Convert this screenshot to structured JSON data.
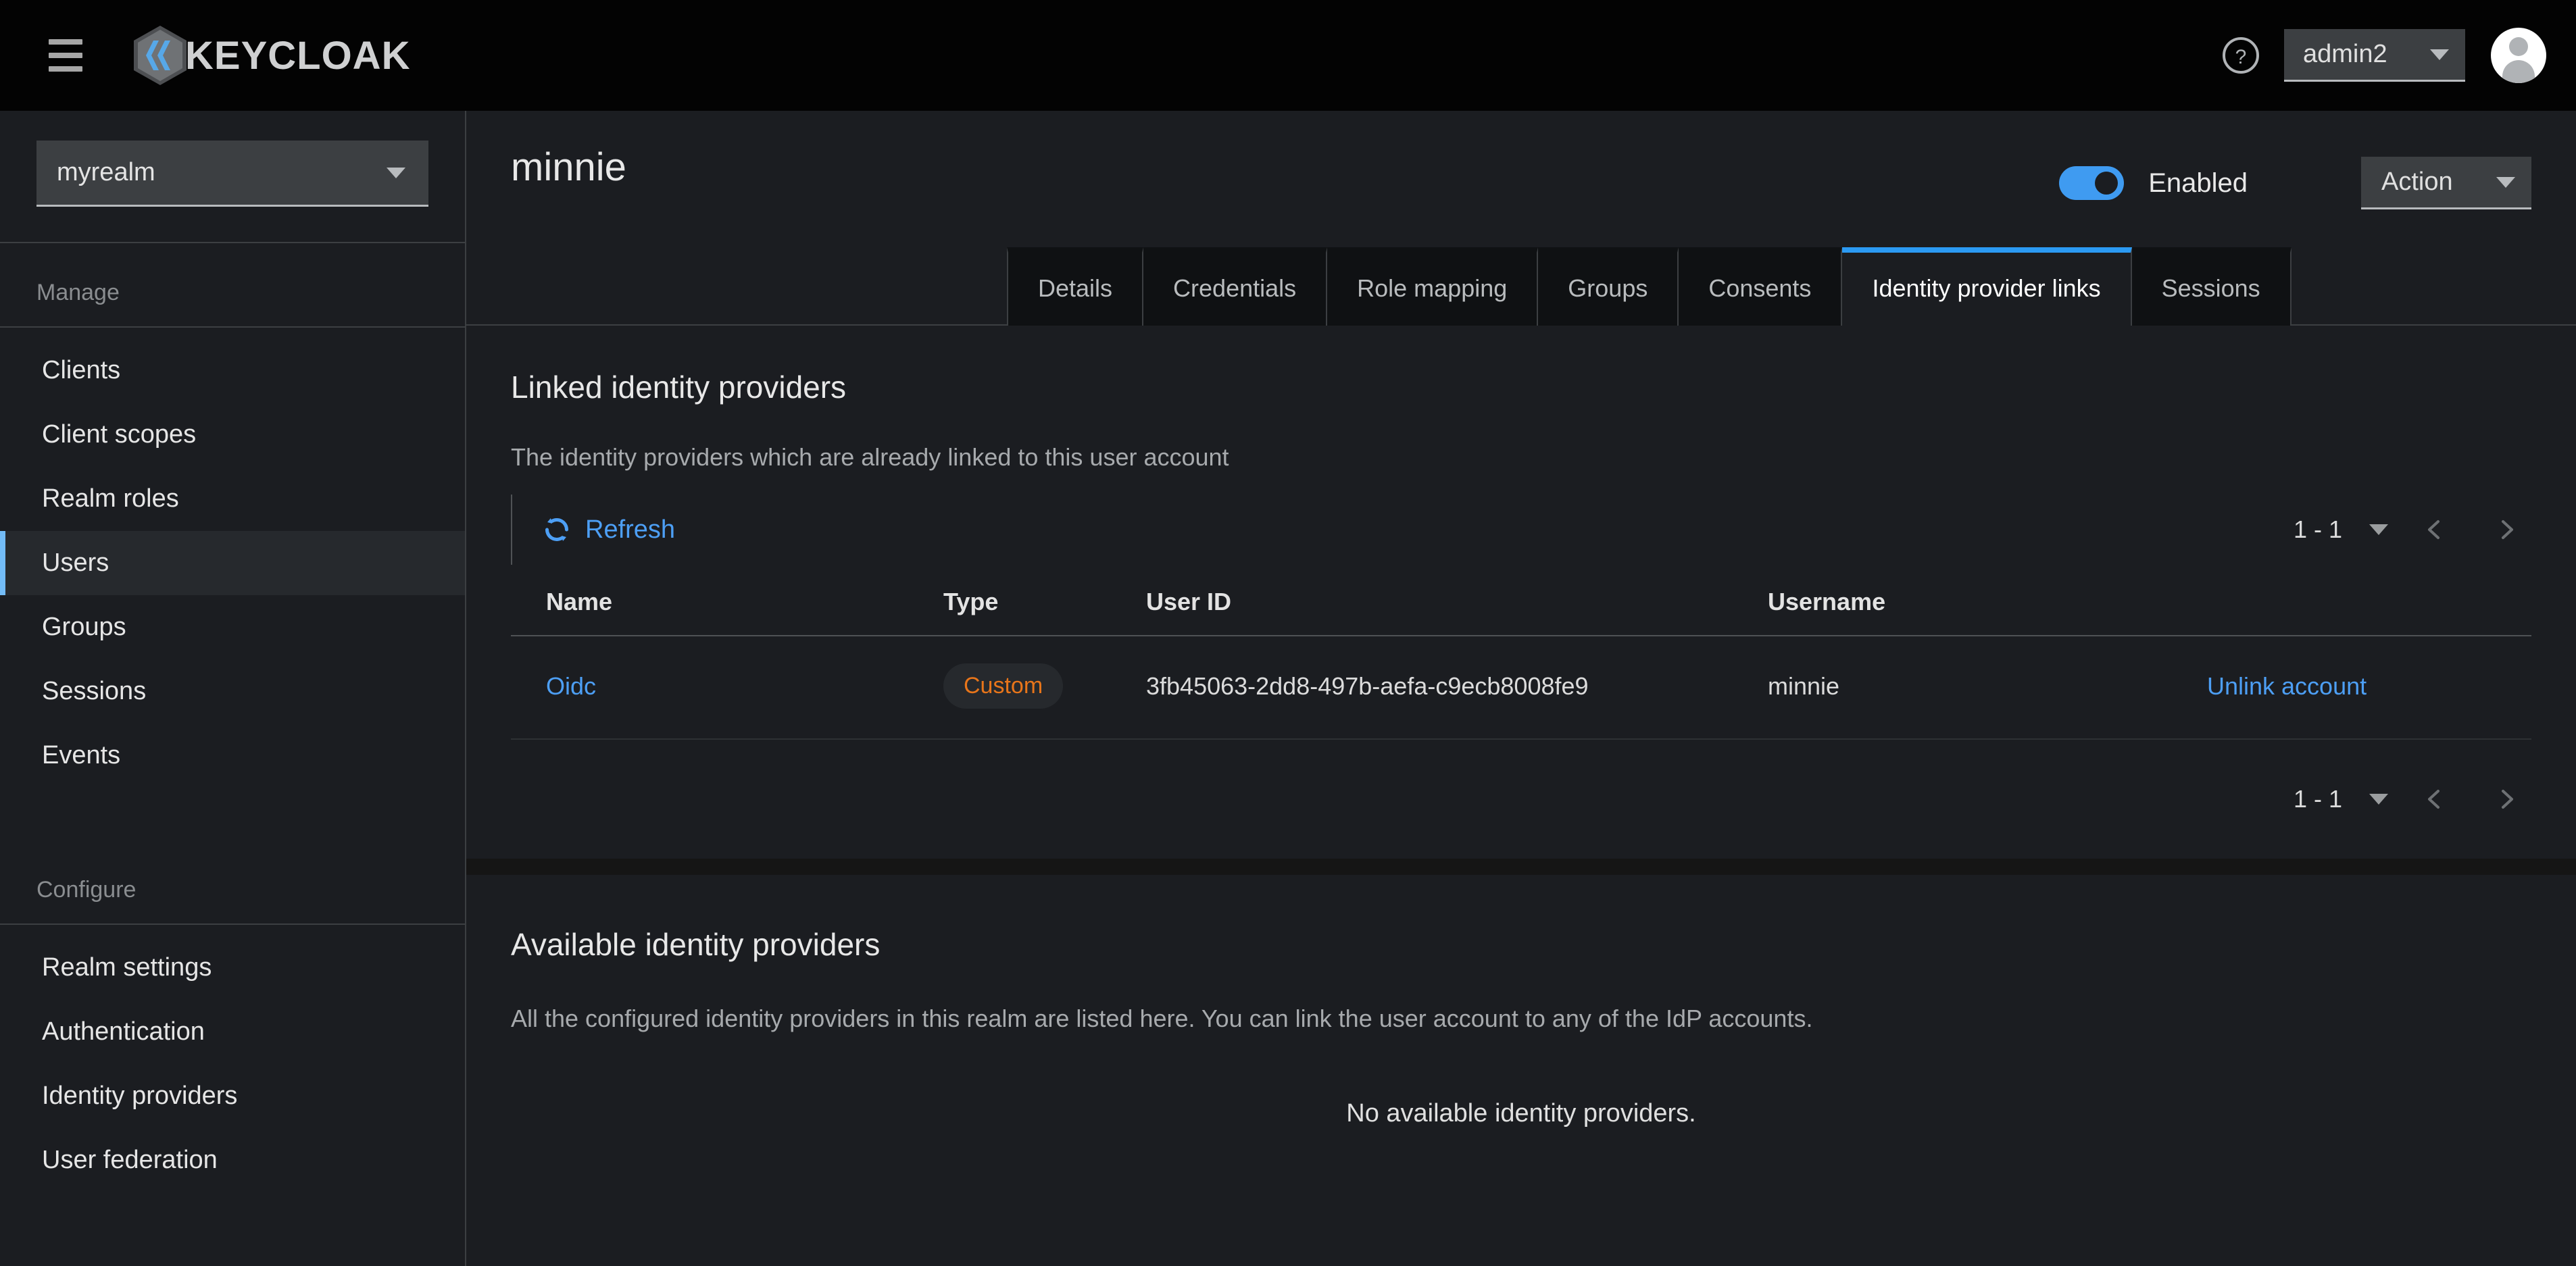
{
  "masthead": {
    "menu_icon": "hamburger-icon",
    "brand_name": "KEYCLOAK",
    "help_icon": "help-circle-icon",
    "user_name": "admin2",
    "avatar_icon": "user-avatar-icon"
  },
  "sidebar": {
    "realm_selected": "myrealm",
    "groups": [
      {
        "title": "Manage",
        "items": [
          {
            "label": "Clients",
            "active": false
          },
          {
            "label": "Client scopes",
            "active": false
          },
          {
            "label": "Realm roles",
            "active": false
          },
          {
            "label": "Users",
            "active": true
          },
          {
            "label": "Groups",
            "active": false
          },
          {
            "label": "Sessions",
            "active": false
          },
          {
            "label": "Events",
            "active": false
          }
        ]
      },
      {
        "title": "Configure",
        "items": [
          {
            "label": "Realm settings",
            "active": false
          },
          {
            "label": "Authentication",
            "active": false
          },
          {
            "label": "Identity providers",
            "active": false
          },
          {
            "label": "User federation",
            "active": false
          }
        ]
      }
    ]
  },
  "page": {
    "title": "minnie",
    "enabled_toggle_on": true,
    "enabled_label": "Enabled",
    "action_label": "Action"
  },
  "tabs": [
    {
      "label": "Details",
      "active": false
    },
    {
      "label": "Credentials",
      "active": false
    },
    {
      "label": "Role mapping",
      "active": false
    },
    {
      "label": "Groups",
      "active": false
    },
    {
      "label": "Consents",
      "active": false
    },
    {
      "label": "Identity provider links",
      "active": true
    },
    {
      "label": "Sessions",
      "active": false
    }
  ],
  "linked_section": {
    "heading": "Linked identity providers",
    "description": "The identity providers which are already linked to this user account",
    "refresh_label": "Refresh",
    "refresh_icon": "refresh-icon",
    "pagination_top": {
      "range": "1 - 1",
      "prev_icon": "chevron-left-icon",
      "next_icon": "chevron-right-icon"
    },
    "pagination_bottom": {
      "range": "1 - 1",
      "prev_icon": "chevron-left-icon",
      "next_icon": "chevron-right-icon"
    },
    "columns": [
      "Name",
      "Type",
      "User ID",
      "Username",
      ""
    ],
    "rows": [
      {
        "name": "Oidc",
        "type": "Custom",
        "user_id": "3fb45063-2dd8-497b-aefa-c9ecb8008fe9",
        "username": "minnie",
        "action": "Unlink account"
      }
    ]
  },
  "available_section": {
    "heading": "Available identity providers",
    "description": "All the configured identity providers in this realm are listed here. You can link the user account to any of the IdP accounts.",
    "empty_message": "No available identity providers."
  },
  "colors": {
    "accent_blue": "#2b9af3",
    "link_blue": "#4d9ff5",
    "badge_orange": "#e8751a",
    "masthead_bg": "#030303",
    "panel_bg": "#1b1d21"
  }
}
